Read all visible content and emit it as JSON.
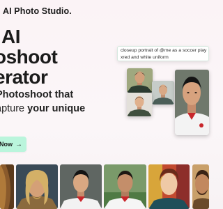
{
  "header": {
    "brand": "AI Photo Studio."
  },
  "hero": {
    "headline_lines": [
      "AI",
      "oshoot",
      "erator"
    ],
    "sub_line1": "Photoshoot that",
    "sub_line2_plain": "apture ",
    "sub_line2_bold": "your unique",
    "cta_label": "Now",
    "cta_arrow": "→"
  },
  "prompt": {
    "line1": "closeup portrait of @me as a soccer play",
    "line2": "xred and white uniform"
  },
  "colors": {
    "background": "#fbf3f6",
    "cta_background": "#baf5dc",
    "prompt_border": "#d6e8df"
  },
  "icons": {
    "cta_arrow": "arrow-right-icon"
  }
}
